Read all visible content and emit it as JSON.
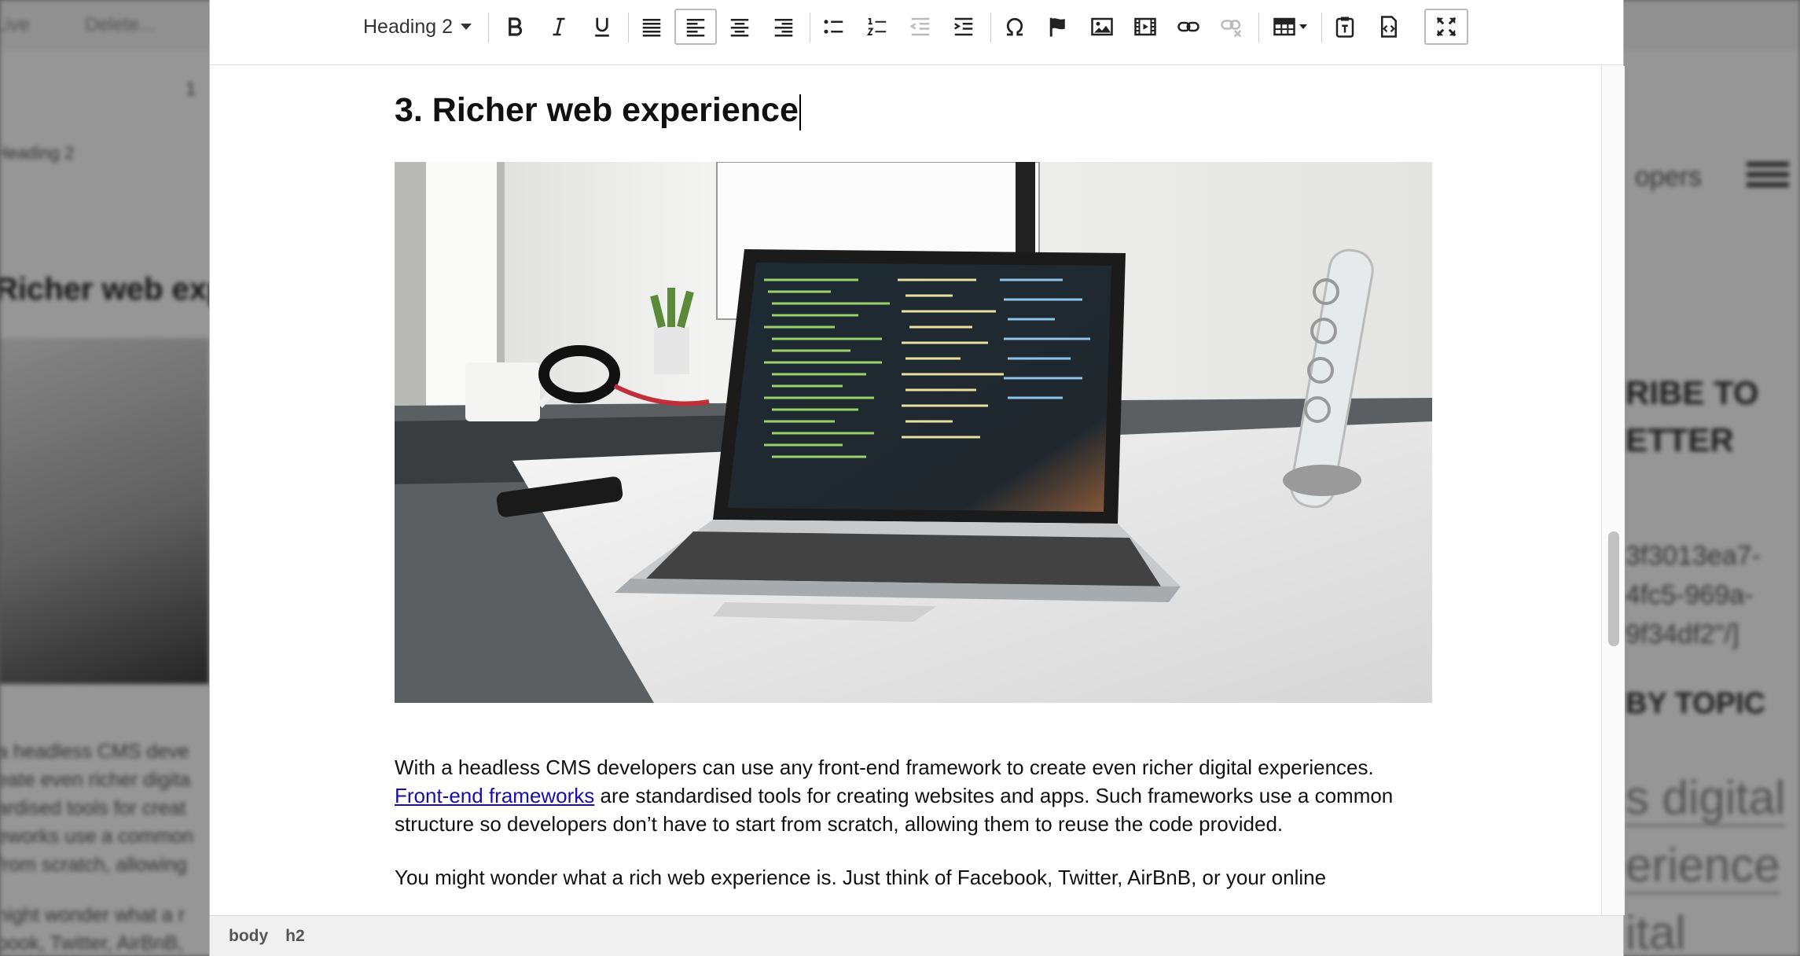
{
  "background_page": {
    "toolbar_left": [
      "Live",
      "Delete..."
    ],
    "step_number": "1",
    "format_label": "Heading 2",
    "heading_fragment": "Richer web exp",
    "para_fragments": [
      "a headless CMS deve",
      "eate even richer digita",
      "ardised tools for creat",
      "eworks use a common",
      "from scratch, allowing",
      "night wonder what a r",
      "book, Twitter, AirBnB,"
    ],
    "right_fragments": {
      "developers": "opers",
      "subscribe": "RIBE TO",
      "newsletter": "ETTER",
      "hash1": "3f3013ea7-",
      "hash2": "4fc5-969a-",
      "hash3": "9f34df2\"/]",
      "by_topic": "BY TOPIC",
      "digital": "s digital",
      "experience": "erience",
      "ital": "ital"
    }
  },
  "toolbar": {
    "format_select": "Heading 2",
    "buttons": [
      {
        "name": "bold-button",
        "icon": "bold-icon"
      },
      {
        "name": "italic-button",
        "icon": "italic-icon"
      },
      {
        "name": "underline-button",
        "icon": "underline-icon"
      },
      {
        "name": "align-justify-button",
        "icon": "align-justify-icon"
      },
      {
        "name": "align-left-button",
        "icon": "align-left-icon",
        "active": true
      },
      {
        "name": "align-center-button",
        "icon": "align-center-icon"
      },
      {
        "name": "align-right-button",
        "icon": "align-right-icon"
      },
      {
        "name": "bullet-list-button",
        "icon": "bullet-list-icon"
      },
      {
        "name": "numbered-list-button",
        "icon": "numbered-list-icon"
      },
      {
        "name": "outdent-button",
        "icon": "outdent-icon",
        "disabled": true
      },
      {
        "name": "indent-button",
        "icon": "indent-icon"
      },
      {
        "name": "special-char-button",
        "icon": "omega-icon"
      },
      {
        "name": "anchor-button",
        "icon": "flag-icon"
      },
      {
        "name": "image-button",
        "icon": "image-icon"
      },
      {
        "name": "media-button",
        "icon": "film-icon"
      },
      {
        "name": "link-button",
        "icon": "link-icon"
      },
      {
        "name": "unlink-button",
        "icon": "unlink-icon",
        "disabled": true
      },
      {
        "name": "table-button",
        "icon": "table-icon"
      },
      {
        "name": "paste-text-button",
        "icon": "paste-text-icon"
      },
      {
        "name": "source-code-button",
        "icon": "code-icon"
      },
      {
        "name": "fullscreen-button",
        "icon": "fullscreen-icon",
        "active": true
      }
    ]
  },
  "document": {
    "heading": "3. Richer web experience",
    "image_alt": "Laptop with code on a desk",
    "paragraph1": {
      "text_before": "With a headless CMS developers can use any front-end framework to create even richer digital experiences. ",
      "link_text": "Front-end frameworks",
      "text_after": " are standardised tools for creating websites and apps. Such frameworks use a common structure so developers don’t have to start from scratch, allowing them to reuse the code provided."
    },
    "paragraph2": "You might wonder what a rich web experience is. Just think of Facebook, Twitter, AirBnB, or your online"
  },
  "statusbar": {
    "path": [
      "body",
      "h2"
    ]
  },
  "colors": {
    "link": "#1a0dab",
    "active_border": "#bbbbbb",
    "statusbar_bg": "#f0f0f0"
  }
}
